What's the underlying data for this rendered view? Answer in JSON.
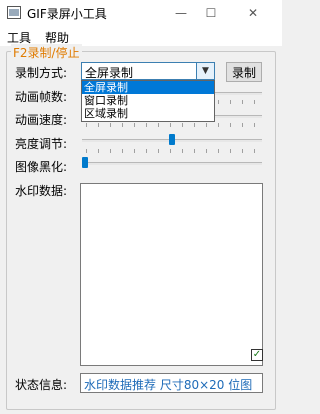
{
  "window": {
    "title": "GIF录屏小工具",
    "minimize_glyph": "—",
    "maximize_glyph": "☐",
    "close_glyph": "✕"
  },
  "menu": {
    "tools": "工具",
    "help": "帮助"
  },
  "group": {
    "legend": "F2录制/停止"
  },
  "labels": {
    "record_mode": "录制方式:",
    "frame_count": "动画帧数:",
    "speed": "动画速度:",
    "brightness": "亮度调节:",
    "blacken": "图像黑化:",
    "watermark": "水印数据:",
    "status": "状态信息:"
  },
  "record_mode": {
    "selected": "全屏录制",
    "options": [
      "全屏录制",
      "窗口录制",
      "区域录制"
    ]
  },
  "record_button": "录制",
  "sliders": {
    "brightness_level": 0.5,
    "blacken_level": 0.0
  },
  "watermark": {
    "text": "",
    "checkbox_checked": true,
    "check_glyph": "✓"
  },
  "status": {
    "text": "水印数据推荐 尺寸80×20 位图"
  },
  "colors": {
    "legend": "#e07b00",
    "accent": "#0078d7",
    "status_text": "#1e6bb8"
  }
}
